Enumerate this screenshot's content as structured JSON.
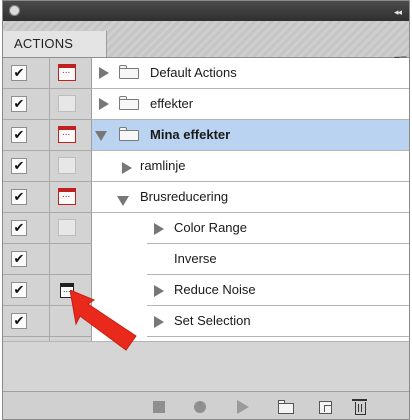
{
  "panel": {
    "tab_label": "ACTIONS",
    "menu_icon": "panel-menu-icon",
    "collapse_icon": "collapse-double-arrow-icon"
  },
  "rows": [
    {
      "toggle": "✔",
      "dialog": "red",
      "type": "set",
      "expanded": false,
      "label": "Default Actions",
      "selected": false
    },
    {
      "toggle": "✔",
      "dialog": "empty",
      "type": "set",
      "expanded": false,
      "label": "effekter",
      "selected": false
    },
    {
      "toggle": "✔",
      "dialog": "red",
      "type": "set",
      "expanded": true,
      "label": "Mina effekter",
      "selected": true
    },
    {
      "toggle": "✔",
      "dialog": "empty",
      "type": "action",
      "expanded": false,
      "label": "ramlinje",
      "selected": false
    },
    {
      "toggle": "✔",
      "dialog": "red",
      "type": "action",
      "expanded": true,
      "label": "Brusreducering",
      "selected": false
    },
    {
      "toggle": "✔",
      "dialog": "empty",
      "type": "command",
      "expanded": false,
      "label": "Color Range",
      "selected": false
    },
    {
      "toggle": "✔",
      "dialog": "none",
      "type": "command",
      "expanded": false,
      "label": "Inverse",
      "selected": false
    },
    {
      "toggle": "✔",
      "dialog": "black",
      "type": "command",
      "expanded": false,
      "label": "Reduce Noise",
      "selected": false
    },
    {
      "toggle": "✔",
      "dialog": "none",
      "type": "command",
      "expanded": false,
      "label": "Set Selection",
      "selected": false
    }
  ],
  "bottom_toolbar": {
    "buttons": [
      "stop-button",
      "record-button",
      "play-button",
      "new-set-button",
      "new-action-button",
      "delete-button"
    ]
  },
  "annotation": {
    "arrow_color": "#e8291c",
    "points_to": "dialog-toggle-reduce-noise"
  },
  "colors": {
    "selected_row": "#b9d3f0",
    "dialog_icon_red": "#c02020"
  }
}
